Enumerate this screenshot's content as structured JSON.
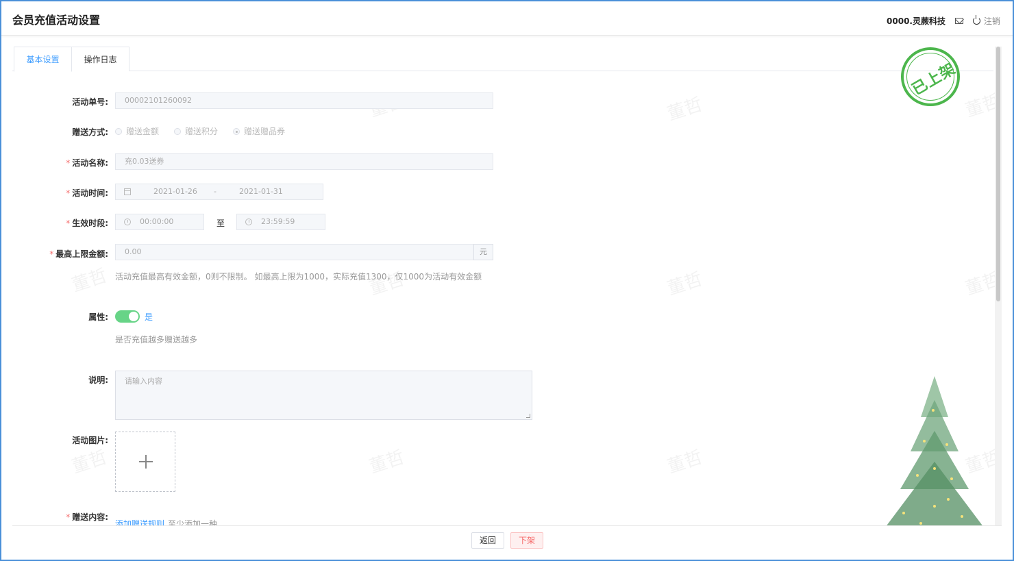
{
  "header": {
    "title": "会员充值活动设置",
    "company": "0000.灵蕨科技",
    "logout_label": "注销"
  },
  "tabs": [
    {
      "label": "基本设置",
      "active": true
    },
    {
      "label": "操作日志",
      "active": false
    }
  ],
  "status_stamp": "已上架",
  "watermark_text": "董哲",
  "form": {
    "activity_no": {
      "label": "活动单号:",
      "value": "00002101260092"
    },
    "gift_method": {
      "label": "赠送方式:",
      "options": [
        "赠送金额",
        "赠送积分",
        "赠送赠品券"
      ],
      "selected": "赠送赠品券"
    },
    "activity_name": {
      "label": "活动名称:",
      "value": "充0.03送券"
    },
    "activity_time": {
      "label": "活动时间:",
      "start": "2021-01-26",
      "separator": "-",
      "end": "2021-01-31"
    },
    "effective_period": {
      "label": "生效时段:",
      "start": "00:00:00",
      "separator": "至",
      "end": "23:59:59"
    },
    "max_amount": {
      "label": "最高上限金额:",
      "value": "0.00",
      "unit": "元",
      "hint": "活动充值最高有效金额，0则不限制。 如最高上限为1000，实际充值1300，仅1000为活动有效金额"
    },
    "attribute": {
      "label": "属性:",
      "on": true,
      "state_text": "是",
      "hint": "是否充值越多赠送越多"
    },
    "description": {
      "label": "说明:",
      "placeholder": "请输入内容"
    },
    "activity_image": {
      "label": "活动图片:"
    },
    "gift_content": {
      "label": "赠送内容:",
      "link": "添加赠送规则",
      "hint": "至少添加一种"
    }
  },
  "footer": {
    "back_label": "返回",
    "off_label": "下架"
  },
  "colors": {
    "accent": "#409eff",
    "required": "#f56c6c",
    "switch_on": "#67d487",
    "stamp": "#4cb64c"
  }
}
